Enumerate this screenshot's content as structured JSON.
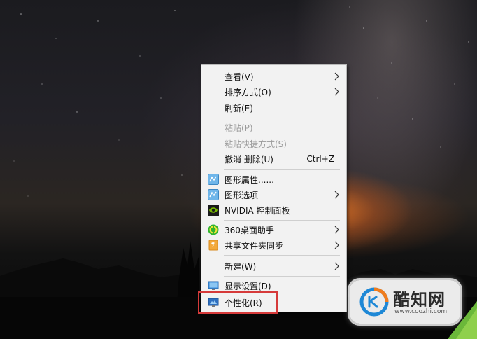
{
  "context_menu": {
    "items": [
      {
        "label": "查看(V)",
        "submenu": true
      },
      {
        "label": "排序方式(O)",
        "submenu": true
      },
      {
        "label": "刷新(E)"
      },
      {
        "label": "粘贴(P)",
        "disabled": true
      },
      {
        "label": "粘贴快捷方式(S)",
        "disabled": true
      },
      {
        "label": "撤消 删除(U)",
        "shortcut": "Ctrl+Z"
      },
      {
        "label": "图形属性......",
        "icon": "intel-graphics-icon"
      },
      {
        "label": "图形选项",
        "icon": "intel-graphics-icon",
        "submenu": true
      },
      {
        "label": "NVIDIA 控制面板",
        "icon": "nvidia-icon"
      },
      {
        "label": "360桌面助手",
        "icon": "360-assistant-icon",
        "submenu": true
      },
      {
        "label": "共享文件夹同步",
        "icon": "shared-folder-sync-icon",
        "submenu": true
      },
      {
        "label": "新建(W)",
        "submenu": true
      },
      {
        "label": "显示设置(D)",
        "icon": "display-settings-icon"
      },
      {
        "label": "个性化(R)",
        "icon": "personalize-icon"
      }
    ]
  },
  "watermark": {
    "title": "酷知网",
    "url": "www.coozhi.com"
  },
  "colors": {
    "menu_background": "#f2f2f2",
    "highlight_border": "#d63a3a"
  }
}
